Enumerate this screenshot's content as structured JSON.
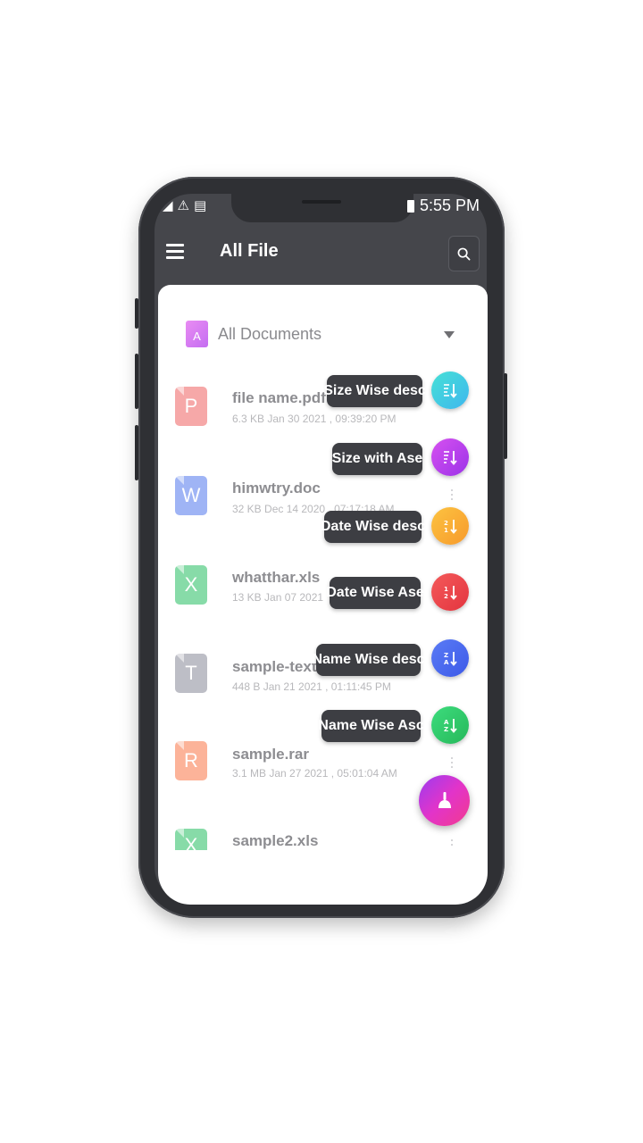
{
  "status_bar": {
    "time": "5:55 PM"
  },
  "app_bar": {
    "title": "All File"
  },
  "dropdown": {
    "selected": "All Documents",
    "icon_letter": "A"
  },
  "files": [
    {
      "name": "file name.pdf",
      "meta": "6.3 KB   Jan 30 2021 , 09:39:20 PM",
      "icon": "pdf-file-icon",
      "letter": "P",
      "color": "#f38b8b"
    },
    {
      "name": "himwtry.doc",
      "meta": "32 KB   Dec 14 2020 , 07:17:18 AM",
      "icon": "doc-file-icon",
      "letter": "W",
      "color": "#7f9bf2"
    },
    {
      "name": "whatthar.xls",
      "meta": "13 KB   Jan 07 2021",
      "icon": "xls-file-icon",
      "letter": "X",
      "color": "#5fd08c"
    },
    {
      "name": "sample-text-f",
      "meta": "448 B   Jan 21 2021 , 01:11:45 PM",
      "icon": "txt-file-icon",
      "letter": "T",
      "color": "#a8a9b4"
    },
    {
      "name": "sample.rar",
      "meta": "3.1 MB   Jan 27 2021 , 05:01:04 AM",
      "icon": "rar-file-icon",
      "letter": "R",
      "color": "#fb9a78"
    },
    {
      "name": "sample2.xls",
      "meta": "",
      "icon": "xls-file-icon",
      "letter": "X",
      "color": "#5fd08c"
    }
  ],
  "sort_options": [
    {
      "label": "Size Wise desc",
      "icon": "size-desc-icon",
      "colors": [
        "#46e0d6",
        "#3fb7ee"
      ],
      "glyph": "≡↓"
    },
    {
      "label": "Size  with Ase",
      "icon": "size-asc-icon",
      "colors": [
        "#d651f0",
        "#9c33e8"
      ],
      "glyph": "≡↓"
    },
    {
      "label": "Date Wise desc",
      "icon": "date-desc-icon",
      "colors": [
        "#fcc341",
        "#f79a2c"
      ],
      "glyph": "2↓"
    },
    {
      "label": "Date Wise Ase",
      "icon": "date-asc-icon",
      "colors": [
        "#f45a5a",
        "#e3343f"
      ],
      "glyph": "1↓"
    },
    {
      "label": "Name Wise desc",
      "icon": "name-desc-icon",
      "colors": [
        "#5a7bf5",
        "#3d5ae8"
      ],
      "glyph": "Z↓"
    },
    {
      "label": "Name Wise Asc",
      "icon": "name-asc-icon",
      "colors": [
        "#3ddc7d",
        "#26b85a"
      ],
      "glyph": "A↓"
    }
  ]
}
